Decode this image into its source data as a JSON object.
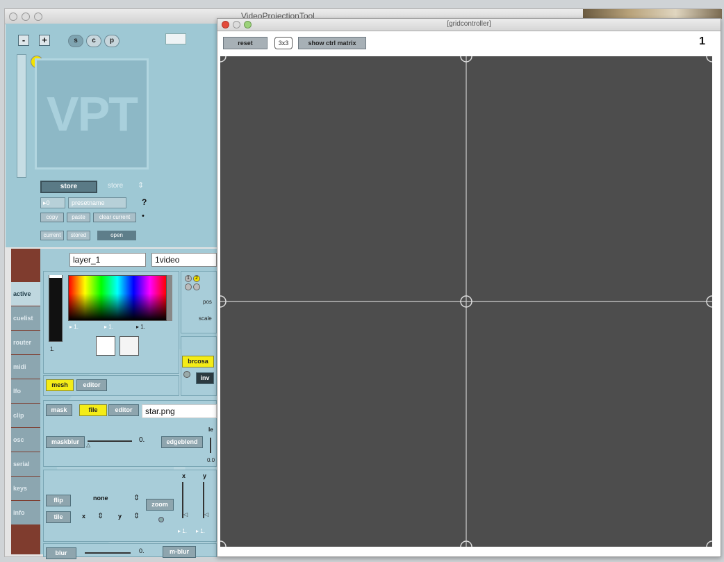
{
  "main_window": {
    "title": "VideoProjectionTool"
  },
  "vpt": {
    "minus": "-",
    "plus": "+",
    "s": "s",
    "c": "c",
    "p": "p",
    "logo": "VPT",
    "badge": "1",
    "store_btn": "store",
    "store_label": "store",
    "preset_index": "0",
    "preset_name": "presetname",
    "question": "?",
    "copy": "copy",
    "paste": "paste",
    "clear_current": "clear current",
    "current": "current",
    "stored": "stored",
    "open": "open"
  },
  "tabs": [
    "active",
    "cuelist",
    "router",
    "midi",
    "lfo",
    "clip",
    "osc",
    "serial",
    "keys",
    "info"
  ],
  "layer": {
    "name": "layer_1",
    "source": "1video",
    "color_vals": [
      "1.",
      "1.",
      "1."
    ],
    "level": "1.",
    "pos": "pos",
    "scale": "scale",
    "brcosa": "brcosa",
    "inv": "inv",
    "mesh": "mesh",
    "editor1": "editor",
    "mask": "mask",
    "file": "file",
    "editor2": "editor",
    "mask_file": "star.png",
    "maskblur": "maskblur",
    "maskblur_val": "0.",
    "edgeblend": "edgeblend",
    "edge_letter": "le",
    "edge_val": "0.0",
    "x_label": "x",
    "y_label": "y",
    "flip": "flip",
    "none": "none",
    "tile": "tile",
    "zoom": "zoom",
    "x_small": "x",
    "y_small": "y",
    "zoom_vals": [
      "1.",
      "1."
    ],
    "blur": "blur",
    "blur_val": "0.",
    "mblur": "m-blur"
  },
  "grid": {
    "title": "[gridcontroller]",
    "reset": "reset",
    "size": "3x3",
    "show_matrix": "show ctrl matrix",
    "number": "1"
  }
}
